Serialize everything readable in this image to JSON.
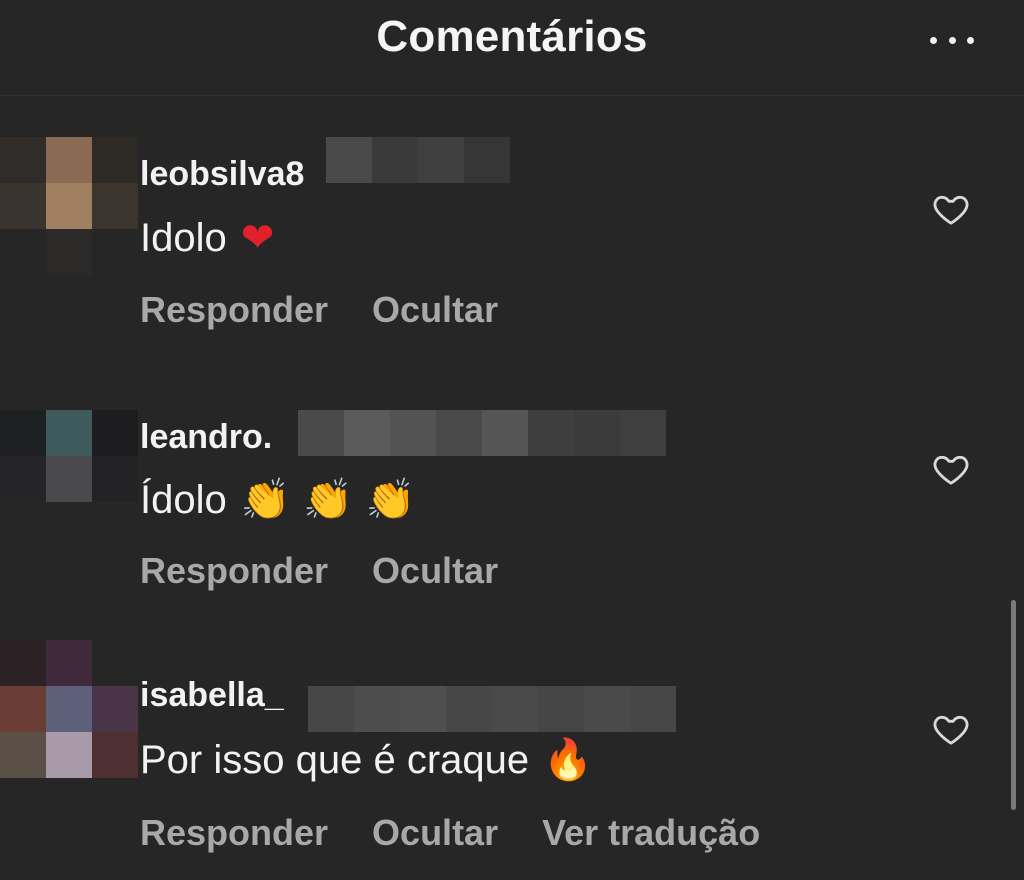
{
  "header": {
    "title": "Comentários",
    "more_icon": "more-horizontal-icon"
  },
  "comments": [
    {
      "username": "leobsilva8",
      "text": "Idolo",
      "emoji": "❤",
      "emoji_name": "red-heart",
      "actions": [
        "Responder",
        "Ocultar"
      ],
      "like_icon": "heart-outline-icon"
    },
    {
      "username": "leandro.",
      "text": "Ídolo",
      "emoji": "👏 👏 👏",
      "emoji_name": "clapping-hands",
      "actions": [
        "Responder",
        "Ocultar"
      ],
      "like_icon": "heart-outline-icon"
    },
    {
      "username": "isabella_",
      "text": "Por isso que é craque",
      "emoji": "🔥",
      "emoji_name": "fire",
      "actions": [
        "Responder",
        "Ocultar",
        "Ver tradução"
      ],
      "like_icon": "heart-outline-icon"
    }
  ],
  "colors": {
    "background": "#262626",
    "primary_text": "#f2f2f2",
    "secondary_text": "#a8a8a8"
  }
}
